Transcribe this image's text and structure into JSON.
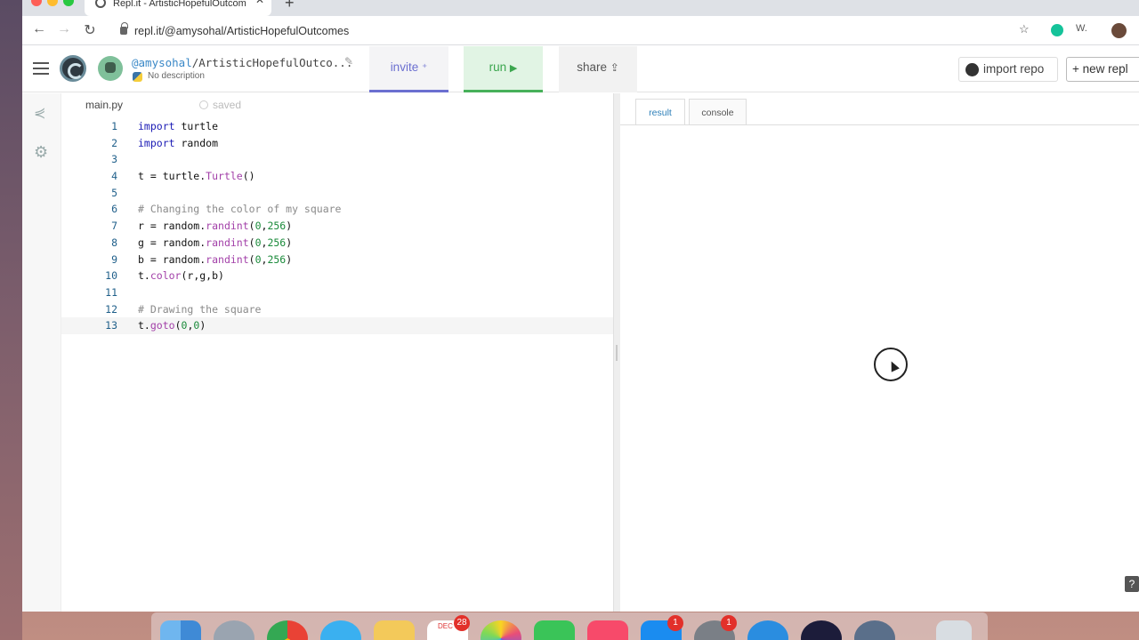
{
  "browser": {
    "tab_title": "Repl.it - ArtisticHopefulOutcom",
    "url": "repl.it/@amysohal/ArtisticHopefulOutcomes",
    "ext_w": "W.",
    "tab_close": "✕",
    "new_tab": "+"
  },
  "header": {
    "user": "@amysohal",
    "project": "/ArtisticHopefulOutco...",
    "description": "No description",
    "invite_label": "invite",
    "run_label": "run",
    "share_label": "share",
    "import_label": "import repo",
    "new_repl_label": "+ new repl"
  },
  "editor": {
    "file_name": "main.py",
    "saved_label": "saved",
    "active_line": 13
  },
  "output": {
    "tabs": [
      "result",
      "console"
    ],
    "active_tab": "result",
    "help_label": "?"
  },
  "dock": {
    "calendar_month": "DEC",
    "calendar_badge": "28",
    "appstore_badge": "1",
    "settings_badge": "1"
  },
  "colors": {
    "run_green": "#3ba64e",
    "invite_purple": "#6b6fd0",
    "keyword": "#1b1bb5",
    "comment": "#8a8a8a",
    "function": "#a23fa8",
    "number": "#1a8a3a"
  }
}
